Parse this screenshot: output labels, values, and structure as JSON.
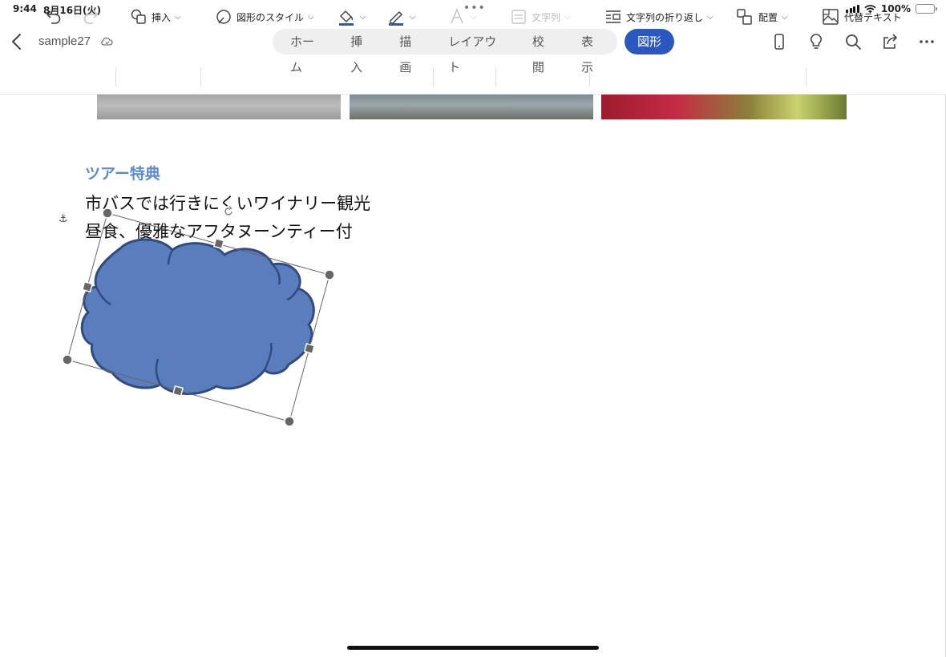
{
  "status": {
    "time": "9:44",
    "date": "8月16日(火)",
    "battery": "100%"
  },
  "topbar": {
    "doc_title": "sample27",
    "tabs": [
      "ホーム",
      "挿入",
      "描画",
      "レイアウト",
      "校閲",
      "表示"
    ],
    "active_tab": "図形"
  },
  "ribbon": {
    "insert": "挿入",
    "shape_style": "図形のスタイル",
    "text": "文字列",
    "wrap": "文字列の折り返し",
    "arrange": "配置",
    "alt_text": "代替テキスト"
  },
  "document": {
    "heading": "ツアー特典",
    "line1": "市バスでは行きにくいワイナリー観光",
    "line2": "昼食、優雅なアフタヌーンティー付"
  },
  "colors": {
    "accent": "#2b58c0",
    "heading": "#5b8ad4",
    "shape_fill": "#5a7dbe",
    "shape_stroke": "#324b7e"
  },
  "shape": {
    "type": "cloud",
    "selected": true
  }
}
